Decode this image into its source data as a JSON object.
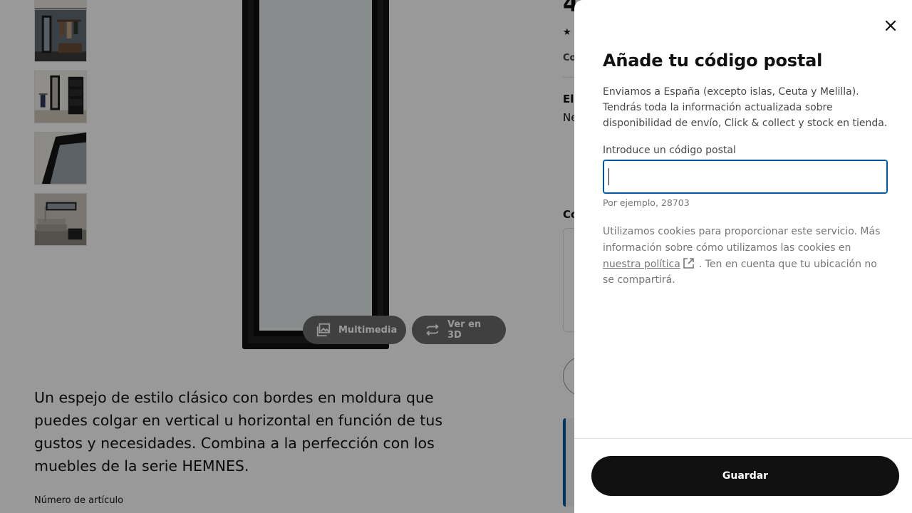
{
  "product_page": {
    "thumbnails": [
      {
        "icon": "mirror-thumb-top-cropped"
      },
      {
        "icon": "mirror-hallway-coat-rack-photo"
      },
      {
        "icon": "mirror-hallway-white-wall-photo"
      },
      {
        "icon": "mirror-frame-closeup-photo"
      },
      {
        "icon": "mirror-living-room-horizontal-photo"
      }
    ],
    "hero_icon": "black-frame-mirror-photo",
    "media_buttons": {
      "multimedia": "Multimedia",
      "view_3d": "Ver en 3D"
    },
    "description": "Un espejo de estilo clásico con bordes en moldura que puedes colgar en vertical u horizontal en función de tus gustos y necesidades. Combina a la perfección con los muebles de la serie HEMNES.",
    "article_number_label": "Número de artículo",
    "right_column_fragments": {
      "price_fragment": "4",
      "rating_fragment": "★",
      "text_a": "Co",
      "text_b": "Eli",
      "text_c": "Ne",
      "text_d": "Có"
    }
  },
  "modal": {
    "title": "Añade tu código postal",
    "intro": "Enviamos a España (excepto islas, Ceuta y Melilla). Tendrás toda la información actualizada sobre disponibilidad de envío, Click & collect y stock en tienda.",
    "zip_field": {
      "label": "Introduce un código postal",
      "value": "",
      "hint": "Por ejemplo, 28703"
    },
    "cookie_note": {
      "before_link": "Utilizamos cookies para proporcionar este servicio. Más información sobre cómo utilizamos las cookies en ",
      "link_text": "nuestra política",
      "after_link": ". Ten en cuenta que tu ubicación no se compartirá."
    },
    "save_label": "Guardar",
    "close_icon": "close-icon"
  },
  "colors": {
    "accent_blue": "#0058a3",
    "primary_button": "#111111",
    "overlay": "rgba(0,0,0,0.40)",
    "muted_text": "#767676"
  }
}
